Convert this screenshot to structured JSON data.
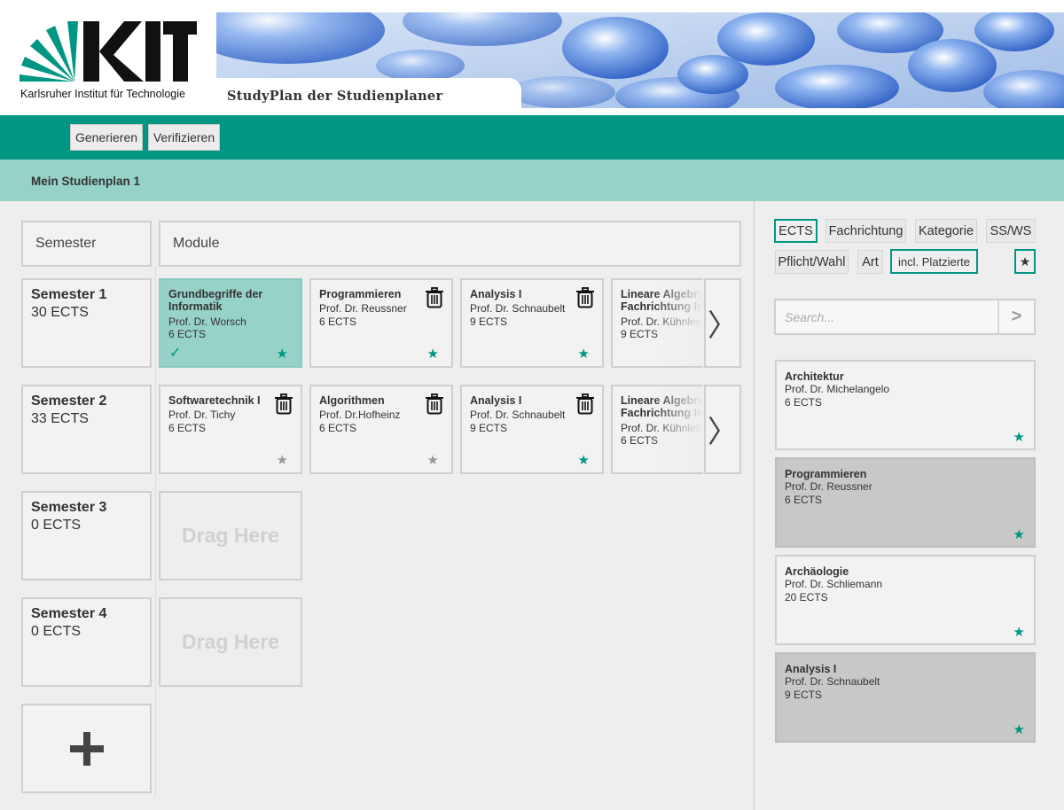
{
  "header": {
    "logo_text": "KIT",
    "logo_subtitle": "Karlsruher Institut für Technologie",
    "app_title": "StudyPlan der Studienplaner"
  },
  "toolbar": {
    "generate_label": "Generieren",
    "verify_label": "Verifizieren"
  },
  "plan": {
    "title": "Mein Studienplan 1"
  },
  "grid": {
    "semester_header": "Semester",
    "module_header": "Module",
    "next_arrow": "〉",
    "drop_placeholder": "Drag Here",
    "add_symbol": "+"
  },
  "semesters": [
    {
      "title": "Semester 1",
      "ects": "30 ECTS",
      "modules": [
        {
          "title": "Grundbegriffe der Informatik",
          "prof": "Prof. Dr. Worsch",
          "ects": "6 ECTS",
          "passed": true,
          "starred": true
        },
        {
          "title": "Programmieren",
          "prof": "Prof. Dr. Reussner",
          "ects": "6 ECTS",
          "starred": true
        },
        {
          "title": "Analysis I",
          "prof": "Prof. Dr. Schnaubelt",
          "ects": "9 ECTS",
          "starred": true
        },
        {
          "title_line1": "Lineare Algebra",
          "title_line2": "Fachrichtung In",
          "prof": "Prof. Dr. Kühnlein",
          "ects": "9 ECTS"
        }
      ]
    },
    {
      "title": "Semester 2",
      "ects": "33 ECTS",
      "modules": [
        {
          "title": "Softwaretechnik I",
          "prof": "Prof. Dr. Tichy",
          "ects": "6 ECTS",
          "starred": false
        },
        {
          "title": "Algorithmen",
          "prof": "Prof. Dr.Hofheinz",
          "ects": "6 ECTS",
          "starred": false
        },
        {
          "title": "Analysis I",
          "prof": "Prof. Dr. Schnaubelt",
          "ects": "9 ECTS",
          "starred": true
        },
        {
          "title_line1": "Lineare Algebra",
          "title_line2": "Fachrichtung In",
          "prof": "Prof. Dr. Kühnlein",
          "ects": "6 ECTS"
        }
      ]
    },
    {
      "title": "Semester 3",
      "ects": "0 ECTS"
    },
    {
      "title": "Semester 4",
      "ects": "0 ECTS"
    }
  ],
  "filters": {
    "ects": "ECTS",
    "fachrichtung": "Fachrichtung",
    "kategorie": "Kategorie",
    "ss_ws": "SS/WS",
    "pflicht_wahl": "Pflicht/Wahl",
    "art": "Art",
    "incl_platzierte": "incl. Platzierte",
    "star": "★"
  },
  "search": {
    "placeholder": "Search...",
    "go_symbol": ">"
  },
  "catalog": [
    {
      "title": "Architektur",
      "prof": "Prof. Dr. Michelangelo",
      "ects": "6 ECTS",
      "placed": false
    },
    {
      "title": "Programmieren",
      "prof": "Prof. Dr. Reussner",
      "ects": "6 ECTS",
      "placed": true
    },
    {
      "title": "Archäologie",
      "prof": "Prof. Dr. Schliemann",
      "ects": "20 ECTS",
      "placed": false
    },
    {
      "title": "Analysis I",
      "prof": "Prof. Dr. Schnaubelt",
      "ects": "9 ECTS",
      "placed": true
    }
  ],
  "symbols": {
    "star": "★",
    "check": "✓"
  },
  "colors": {
    "kit_green": "#009682",
    "kit_light_green": "#96d2c8",
    "star_inactive": "#999999"
  }
}
